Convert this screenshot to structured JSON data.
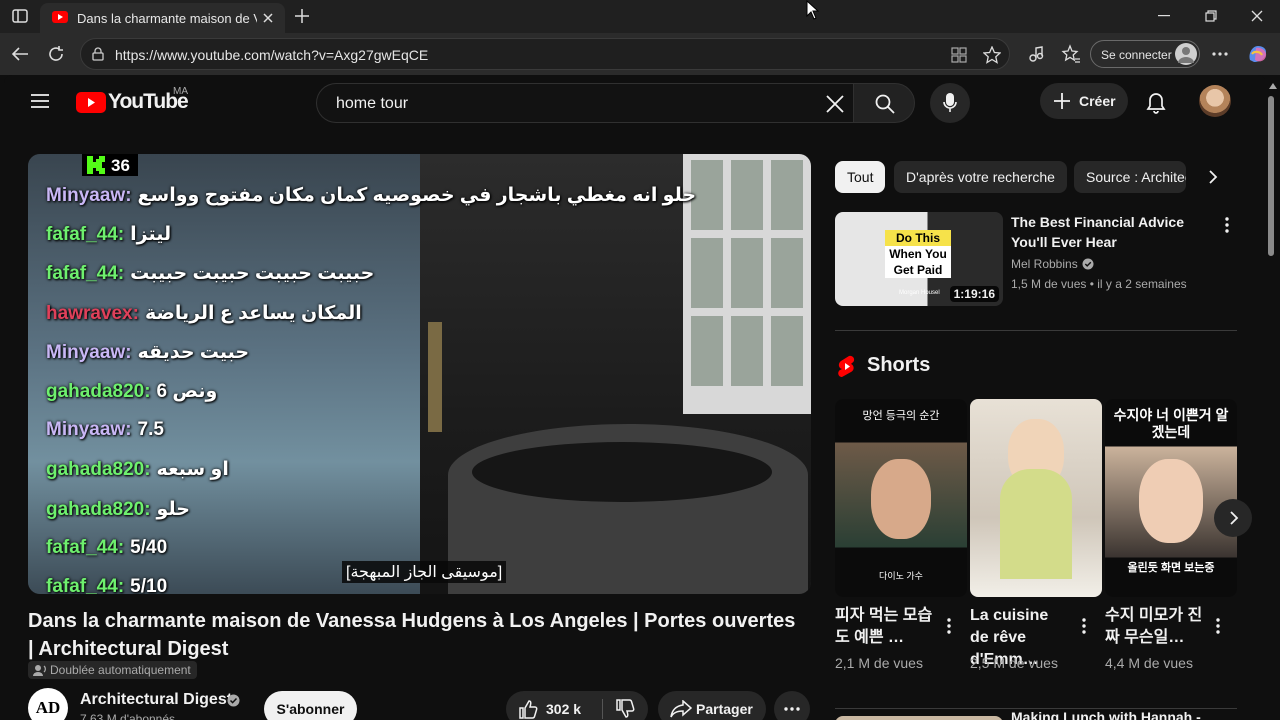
{
  "browser": {
    "tab_title": "Dans la charmante maison de Van",
    "url": "https://www.youtube.com/watch?v=Axg27gwEqCE",
    "signin_label": "Se connecter"
  },
  "youtube": {
    "logo_text": "YouTube",
    "region": "MA",
    "search_query": "home tour",
    "create_label": "Créer"
  },
  "video": {
    "badge_number": "36",
    "chat": [
      {
        "user": "Minyaaw:",
        "msg": "حلو انه مغطي باشجار في خصوصيه كمان مكان مفتوح وواسع",
        "color": "#c9b7f5"
      },
      {
        "user": "fafaf_44:",
        "msg": "ليتزا",
        "color": "#6ef06e"
      },
      {
        "user": "fafaf_44:",
        "msg": "حبيبت حبيبت حبيبت حبيبت",
        "color": "#6ef06e"
      },
      {
        "user": "hawravex:",
        "msg": "المكان يساعد ع الرياضة",
        "color": "#e0405a"
      },
      {
        "user": "Minyaaw:",
        "msg": "حبيت حديقه",
        "color": "#c9b7f5"
      },
      {
        "user": "gahada820:",
        "msg": "6 ونص",
        "color": "#6ef06e"
      },
      {
        "user": "Minyaaw:",
        "msg": "7.5",
        "color": "#c9b7f5"
      },
      {
        "user": "gahada820:",
        "msg": "او سبعه",
        "color": "#6ef06e"
      },
      {
        "user": "gahada820:",
        "msg": "حلو",
        "color": "#6ef06e"
      },
      {
        "user": "fafaf_44:",
        "msg": "5/40",
        "color": "#6ef06e"
      },
      {
        "user": "fafaf_44:",
        "msg": "5/10",
        "color": "#6ef06e"
      }
    ],
    "caption": "[موسيقى الجاز المبهجة]",
    "title": "Dans la charmante maison de Vanessa Hudgens à Los Angeles | Portes ouvertes | Architectural Digest",
    "dub_label": "Doublée automatiquement",
    "channel_initials": "AD",
    "channel_name": "Architectural Digest",
    "channel_subs": "7,63 M d'abonnés",
    "subscribe_label": "S'abonner",
    "likes": "302 k",
    "share_label": "Partager"
  },
  "sidebar": {
    "chips": [
      "Tout",
      "D'après votre recherche",
      "Source : Architectural Digest"
    ],
    "recommended": {
      "title": "The Best Financial Advice You'll Ever Hear",
      "channel": "Mel Robbins",
      "views": "1,5 M de vues",
      "age": "il y a 2 semaines",
      "duration": "1:19:16",
      "thumb_text": [
        "Do This",
        "When You",
        "Get Paid"
      ],
      "thumb_small": "Morgan Housel"
    },
    "shorts_heading": "Shorts",
    "shorts": [
      {
        "title": "피자 먹는 모습도 예쁜 …",
        "views": "2,1 M de vues",
        "top_text": "망언 등극의 순간",
        "bottom_text": "다이노 가수"
      },
      {
        "title": "La cuisine de rêve d'Emm…",
        "views": "2,5 M de vues",
        "top_text": "",
        "bottom_text": ""
      },
      {
        "title": "수지 미모가 진짜 무슨일…",
        "views": "4,4 M de vues",
        "top_text": "수지야 너 이쁜거 알겠는데",
        "bottom_text": "올린듯 화면 보는중"
      }
    ],
    "next_video_title": "Making Lunch with Hannah -"
  },
  "colors": {
    "youtube_red": "#ff0000",
    "accent": "#3ea6ff"
  }
}
